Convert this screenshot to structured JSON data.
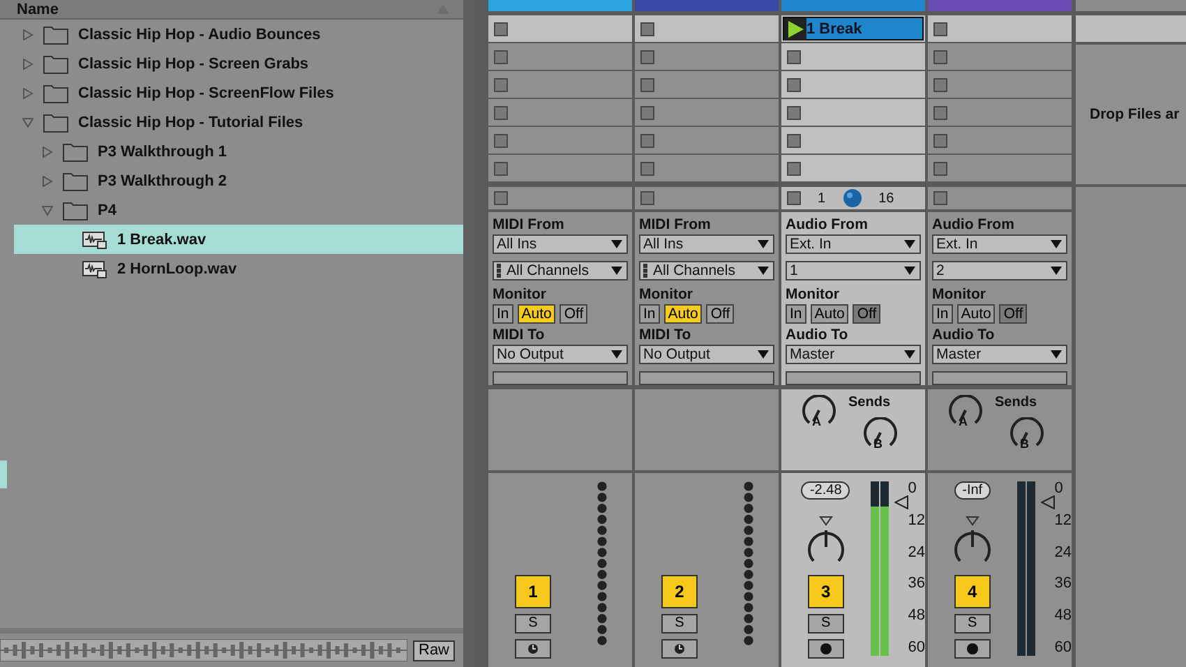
{
  "browser": {
    "header": "Name",
    "items": [
      {
        "name": "Classic Hip Hop - Audio Bounces",
        "kind": "folder",
        "expanded": false,
        "selected": false
      },
      {
        "name": "Classic Hip Hop - Screen Grabs",
        "kind": "folder",
        "expanded": false,
        "selected": false
      },
      {
        "name": "Classic Hip Hop - ScreenFlow Files",
        "kind": "folder",
        "expanded": false,
        "selected": false
      },
      {
        "name": "Classic Hip Hop - Tutorial Files",
        "kind": "folder",
        "expanded": true,
        "selected": false,
        "children": [
          {
            "name": "P3 Walkthrough 1",
            "kind": "folder",
            "expanded": false,
            "selected": false
          },
          {
            "name": "P3 Walkthrough 2",
            "kind": "folder",
            "expanded": false,
            "selected": false
          },
          {
            "name": "P4",
            "kind": "folder",
            "expanded": true,
            "selected": false,
            "children": [
              {
                "name": "1 Break.wav",
                "kind": "file",
                "selected": true
              },
              {
                "name": "2 HornLoop.wav",
                "kind": "file",
                "selected": false
              }
            ]
          }
        ]
      }
    ]
  },
  "preview": {
    "button": "Raw"
  },
  "tracks": [
    {
      "kind": "midi",
      "color": "#2aa4dc",
      "selected": false,
      "clips": [
        {
          "kind": "empty"
        },
        {
          "kind": "empty"
        },
        {
          "kind": "empty"
        },
        {
          "kind": "empty"
        },
        {
          "kind": "empty"
        },
        {
          "kind": "empty"
        }
      ],
      "io": {
        "from_label": "MIDI From",
        "from": "All Ins",
        "channel": "All Channels",
        "monitor_label": "Monitor",
        "monitor": [
          {
            "label": "In",
            "selected": false
          },
          {
            "label": "Auto",
            "selected": true
          },
          {
            "label": "Off",
            "selected": false
          }
        ],
        "to_label": "MIDI To",
        "to": "No Output"
      },
      "mixer": {
        "number": "1",
        "active": true,
        "solo": "S"
      }
    },
    {
      "kind": "midi",
      "color": "#3a48a8",
      "selected": false,
      "clips": [
        {
          "kind": "empty"
        },
        {
          "kind": "empty"
        },
        {
          "kind": "empty"
        },
        {
          "kind": "empty"
        },
        {
          "kind": "empty"
        },
        {
          "kind": "empty"
        }
      ],
      "io": {
        "from_label": "MIDI From",
        "from": "All Ins",
        "channel": "All Channels",
        "monitor_label": "Monitor",
        "monitor": [
          {
            "label": "In",
            "selected": false
          },
          {
            "label": "Auto",
            "selected": true
          },
          {
            "label": "Off",
            "selected": false
          }
        ],
        "to_label": "MIDI To",
        "to": "No Output"
      },
      "mixer": {
        "number": "2",
        "active": true,
        "solo": "S"
      }
    },
    {
      "kind": "audio",
      "color": "#1e86cc",
      "selected": true,
      "clips": [
        {
          "kind": "clip",
          "name": "1 Break"
        },
        {
          "kind": "empty"
        },
        {
          "kind": "empty"
        },
        {
          "kind": "empty"
        },
        {
          "kind": "empty"
        },
        {
          "kind": "empty"
        }
      ],
      "input_range": {
        "low": "1",
        "high": "16"
      },
      "io": {
        "from_label": "Audio From",
        "from": "Ext. In",
        "channel": "1",
        "monitor_label": "Monitor",
        "monitor": [
          {
            "label": "In",
            "selected": false
          },
          {
            "label": "Auto",
            "selected": false
          },
          {
            "label": "Off",
            "selected": true
          }
        ],
        "to_label": "Audio To",
        "to": "Master"
      },
      "sends": {
        "label": "Sends",
        "knobs": [
          "A",
          "B"
        ]
      },
      "mixer": {
        "number": "3",
        "active": true,
        "solo": "S",
        "volume": "-2.48",
        "level": 0.86,
        "scale": [
          "0",
          "12",
          "24",
          "36",
          "48",
          "60"
        ]
      }
    },
    {
      "kind": "audio",
      "color": "#6a4cb4",
      "selected": false,
      "clips": [
        {
          "kind": "empty"
        },
        {
          "kind": "empty"
        },
        {
          "kind": "empty"
        },
        {
          "kind": "empty"
        },
        {
          "kind": "empty"
        },
        {
          "kind": "empty"
        }
      ],
      "io": {
        "from_label": "Audio From",
        "from": "Ext. In",
        "channel": "2",
        "monitor_label": "Monitor",
        "monitor": [
          {
            "label": "In",
            "selected": false
          },
          {
            "label": "Auto",
            "selected": false
          },
          {
            "label": "Off",
            "selected": true
          }
        ],
        "to_label": "Audio To",
        "to": "Master"
      },
      "sends": {
        "label": "Sends",
        "knobs": [
          "A",
          "B"
        ]
      },
      "mixer": {
        "number": "4",
        "active": true,
        "solo": "S",
        "volume": "-Inf",
        "level": 0,
        "scale": [
          "0",
          "12",
          "24",
          "36",
          "48",
          "60"
        ]
      }
    }
  ],
  "drop_area": {
    "text": "Drop Files ar"
  }
}
